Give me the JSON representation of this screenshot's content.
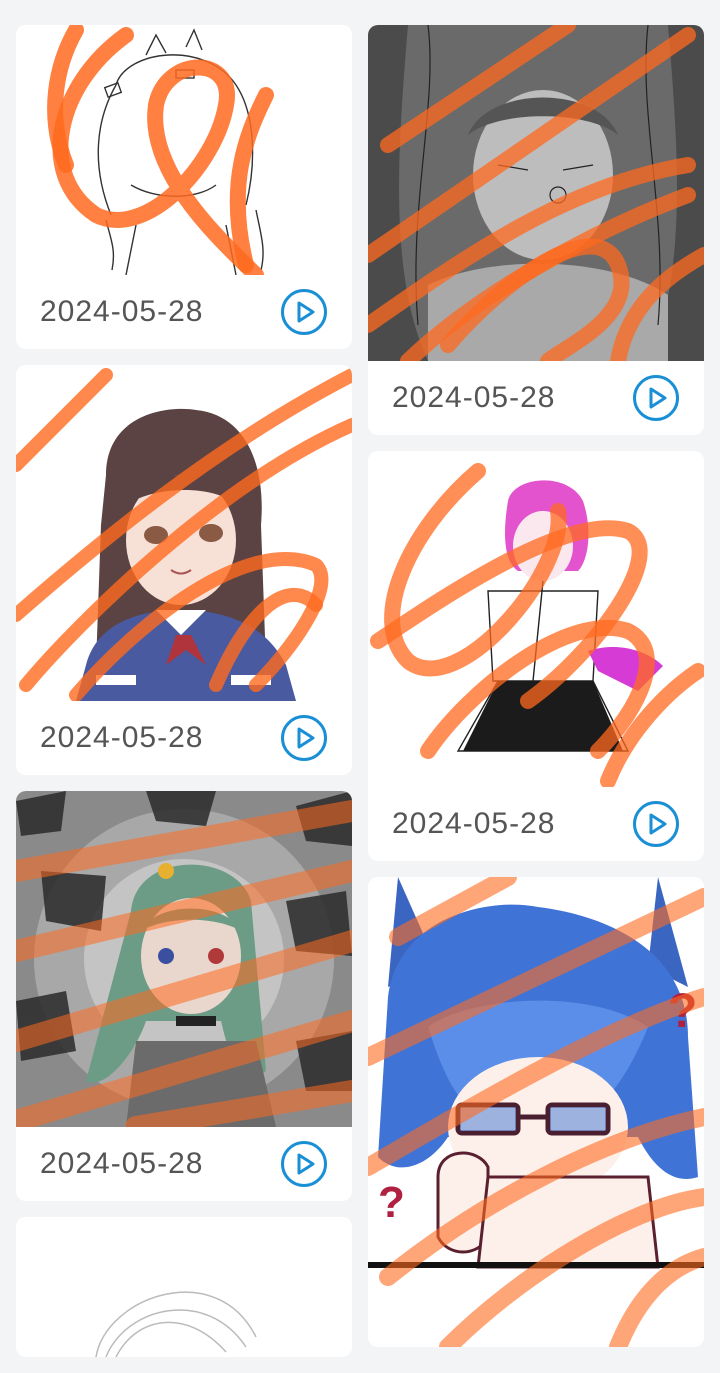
{
  "header": {
    "partial_title": ""
  },
  "cards_left": [
    {
      "date": "2024-05-28",
      "thumb": "sketch-girl-lineart-orange-scribble",
      "play_icon": "play-circle-icon"
    },
    {
      "date": "2024-05-28",
      "thumb": "brown-hair-girl-blue-dress-orange-scribble",
      "play_icon": "play-circle-icon"
    },
    {
      "date": "2024-05-28",
      "thumb": "green-hair-girl-grey-background-orange-scribble",
      "play_icon": "play-circle-icon"
    },
    {
      "date": "",
      "thumb": "sketch-circle-partial",
      "play_icon": "play-circle-icon"
    }
  ],
  "cards_right": [
    {
      "date": "2024-05-28",
      "thumb": "greyscale-girl-orange-scribble",
      "play_icon": "play-circle-icon"
    },
    {
      "date": "2024-05-28",
      "thumb": "pink-hair-girl-black-skirt-orange-scribble",
      "play_icon": "play-circle-icon"
    },
    {
      "date": "",
      "thumb": "blue-hair-catboy-glasses-orange-scribble",
      "play_icon": "play-circle-icon"
    }
  ],
  "colors": {
    "background": "#f3f4f6",
    "card": "#ffffff",
    "date_text": "#555555",
    "play_accent": "#1a8fd6",
    "scribble": "#ff6a1f"
  }
}
